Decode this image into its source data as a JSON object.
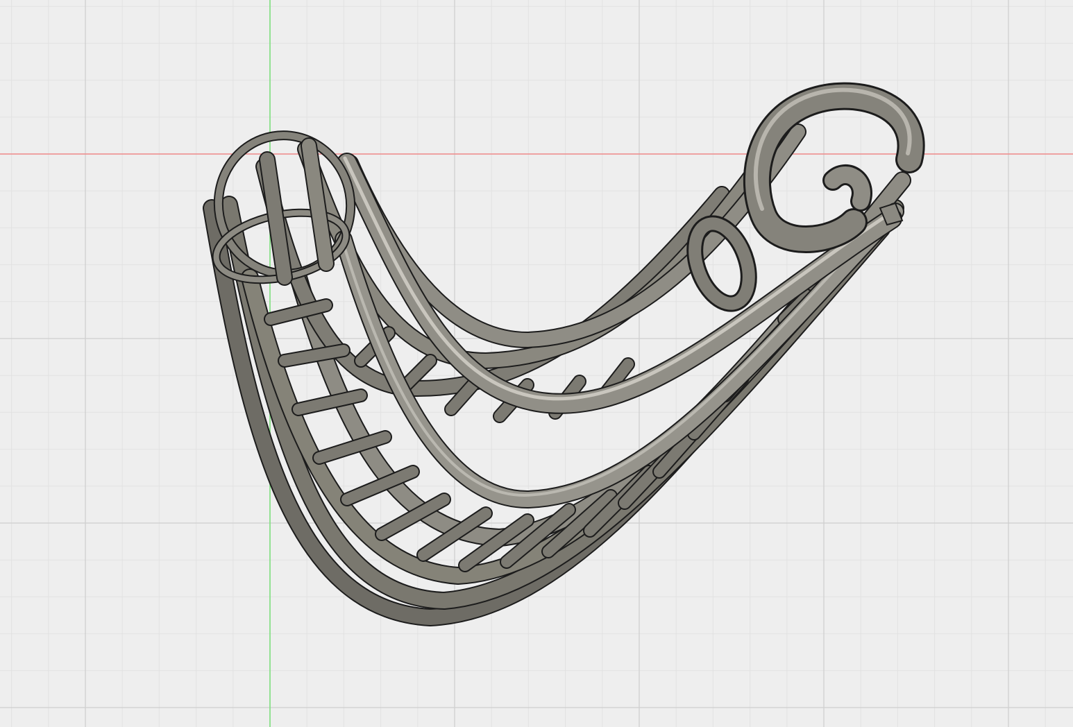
{
  "viewport": {
    "background": "#eeeeee",
    "grid": true,
    "grid_minor_color": "#e2e2e2",
    "grid_major_color": "#cfcfcf",
    "x_axis_color": "#f08a8a",
    "y_axis_color": "#7ee07e"
  },
  "model": {
    "body_color": "#8a8880",
    "edge_color": "#1a1a1a",
    "highlight_color": "#c9c7bf",
    "shadow_color": "#55534d"
  }
}
